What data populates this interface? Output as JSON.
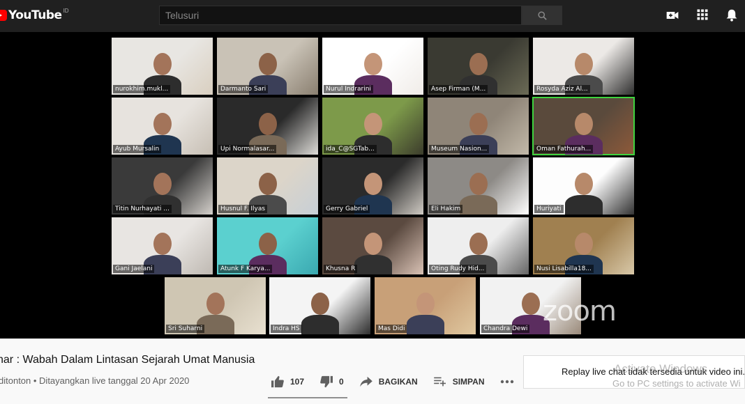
{
  "header": {
    "logo_text": "YouTube",
    "country": "ID",
    "search_placeholder": "Telusuri"
  },
  "participants": [
    "nurokhim.mukl...",
    "Darmanto Sari",
    "Nurul Indrarini",
    "Asep Firman (M...",
    "Rosyda Aziz Al...",
    "Ayub Mursalin",
    "Upi Normalasar...",
    "ida_C@SGTab...",
    "Museum Nasion...",
    "Oman Fathurah...",
    "Titin Nurhayati ...",
    "Husnul F. Ilyas",
    "Gerry Gabriel",
    "Eli Hakim",
    "Huriyati",
    "Gani Jaelani",
    "Atunk F Karya...",
    "Khusna R",
    "Oting Rudy Hid...",
    "Nusi Lisabilla18...",
    "Sri Suharni",
    "Indra HS",
    "Mas Didi",
    "Chandra Dewi"
  ],
  "watermark": "zoom",
  "video": {
    "title": "nar : Wabah Dalam Lintasan Sejarah Umat Manusia",
    "meta": "ditonton • Ditayangkan live tanggal 20 Apr 2020",
    "likes": "107",
    "dislikes": "0",
    "share_label": "BAGIKAN",
    "save_label": "SIMPAN"
  },
  "chat": {
    "message": "Replay live chat tidak tersedia untuk video ini."
  },
  "overlay": {
    "line1": "Activate Windows",
    "line2": "Go to PC settings to activate Wi"
  },
  "colors": {
    "topbar": "#202020",
    "brand_red": "#ff0000",
    "active_speaker": "#3fd43f"
  }
}
